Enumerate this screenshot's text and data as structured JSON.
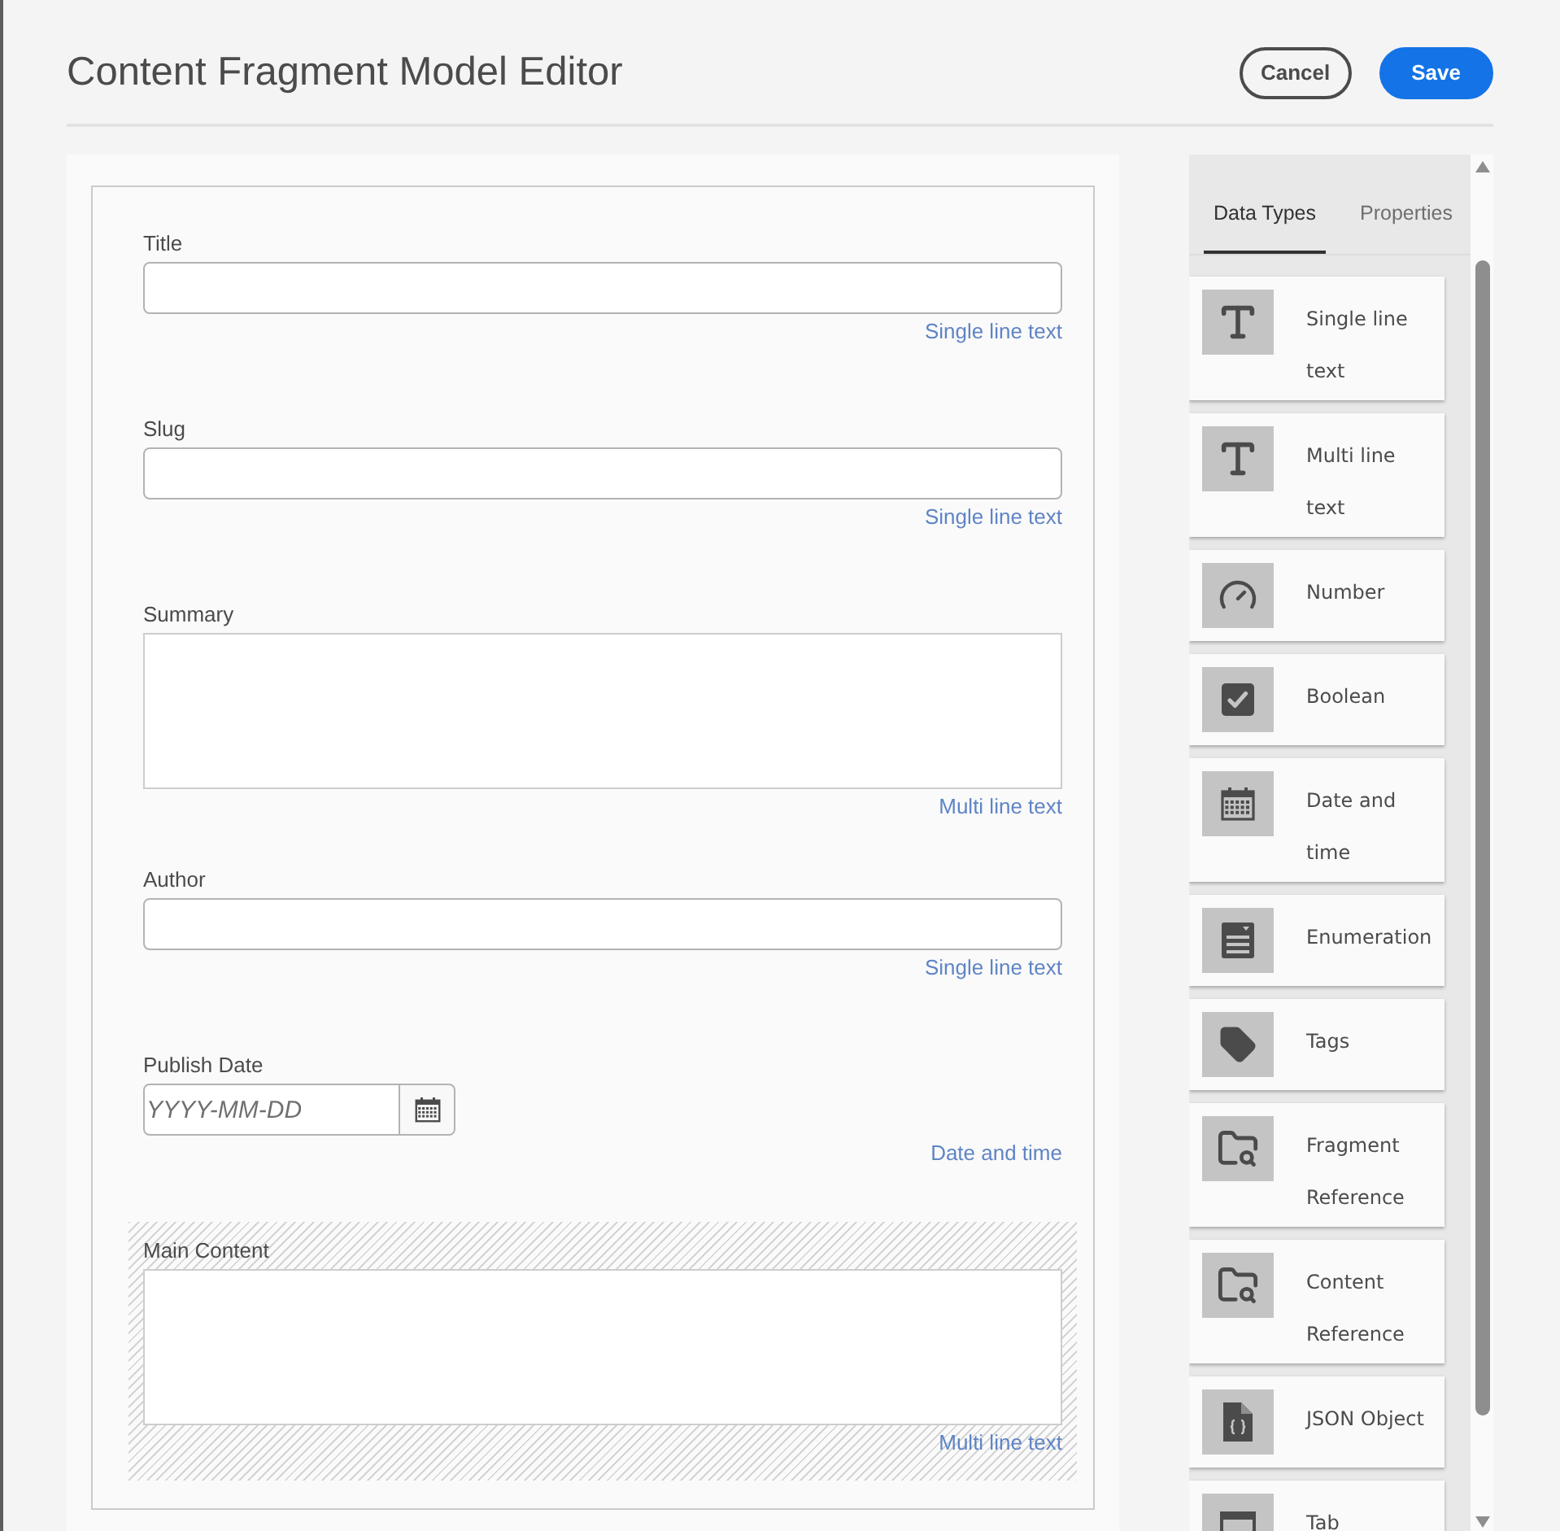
{
  "header": {
    "title": "Content Fragment Model Editor",
    "buttons": [
      {
        "label": "Cancel",
        "kind": "secondary"
      },
      {
        "label": "Save",
        "kind": "primary"
      }
    ]
  },
  "form": {
    "fields": [
      {
        "label": "Title",
        "kind": "text",
        "type_label": "Single line text",
        "selected": false
      },
      {
        "label": "Slug",
        "kind": "text",
        "type_label": "Single line text",
        "selected": false
      },
      {
        "label": "Summary",
        "kind": "textarea",
        "type_label": "Multi line text",
        "selected": false
      },
      {
        "label": "Author",
        "kind": "text",
        "type_label": "Single line text",
        "selected": false
      },
      {
        "label": "Publish Date",
        "kind": "date",
        "placeholder": "YYYY-MM-DD",
        "type_label": "Date and time",
        "selected": false
      },
      {
        "label": "Main Content",
        "kind": "textarea",
        "type_label": "Multi line text",
        "selected": true
      }
    ]
  },
  "sidebar": {
    "tabs": [
      {
        "label": "Data Types",
        "selected": true
      },
      {
        "label": "Properties",
        "selected": false
      }
    ],
    "data_types": [
      {
        "label": "Single line text",
        "kind": "single_line"
      },
      {
        "label": "Multi line text",
        "kind": "multi_line"
      },
      {
        "label": "Number",
        "kind": "number"
      },
      {
        "label": "Boolean",
        "kind": "boolean"
      },
      {
        "label": "Date and time",
        "kind": "date_time"
      },
      {
        "label": "Enumeration",
        "kind": "enumeration"
      },
      {
        "label": "Tags",
        "kind": "tags"
      },
      {
        "label": "Fragment Reference",
        "kind": "fragment_reference"
      },
      {
        "label": "Content Reference",
        "kind": "content_reference"
      },
      {
        "label": "JSON Object",
        "kind": "json"
      },
      {
        "label": "Tab",
        "kind": "tab"
      }
    ]
  }
}
